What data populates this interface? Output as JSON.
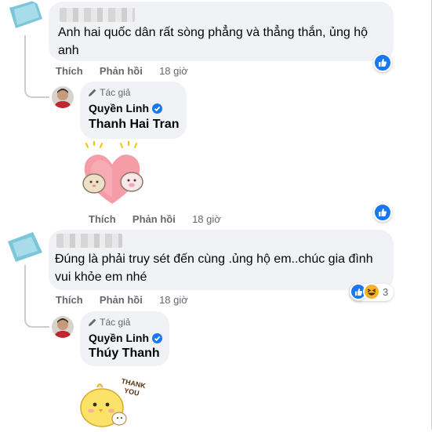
{
  "comments": [
    {
      "text": "Anh hai quốc dân rất sòng phẳng và thẳng thắn, ủng hộ anh",
      "actions": {
        "like": "Thích",
        "reply": "Phản hồi",
        "time": "18 giờ"
      },
      "reply": {
        "author_tag": "Tác giả",
        "author_name": "Quyền Linh",
        "mention": "Thanh Hai Tran",
        "sticker": "heart-hug-sticker",
        "actions": {
          "like": "Thích",
          "reply": "Phản hồi",
          "time": "18 giờ"
        }
      }
    },
    {
      "text": "Đúng là phải truy sét đến cùng .ủng hộ em..chúc gia đình vui khỏe em nhé",
      "actions": {
        "like": "Thích",
        "reply": "Phản hồi",
        "time": "18 giờ"
      },
      "reaction_count": "3",
      "reply": {
        "author_tag": "Tác giả",
        "author_name": "Quyền Linh",
        "mention": "Thúy Thanh",
        "sticker": "thank-you-chick-sticker"
      }
    }
  ],
  "colors": {
    "like_blue": "#1877f2",
    "bubble": "#f0f2f5",
    "muted": "#65676b",
    "haha_yellow": "#f7b125"
  },
  "sticker_text": "THANK YOU"
}
